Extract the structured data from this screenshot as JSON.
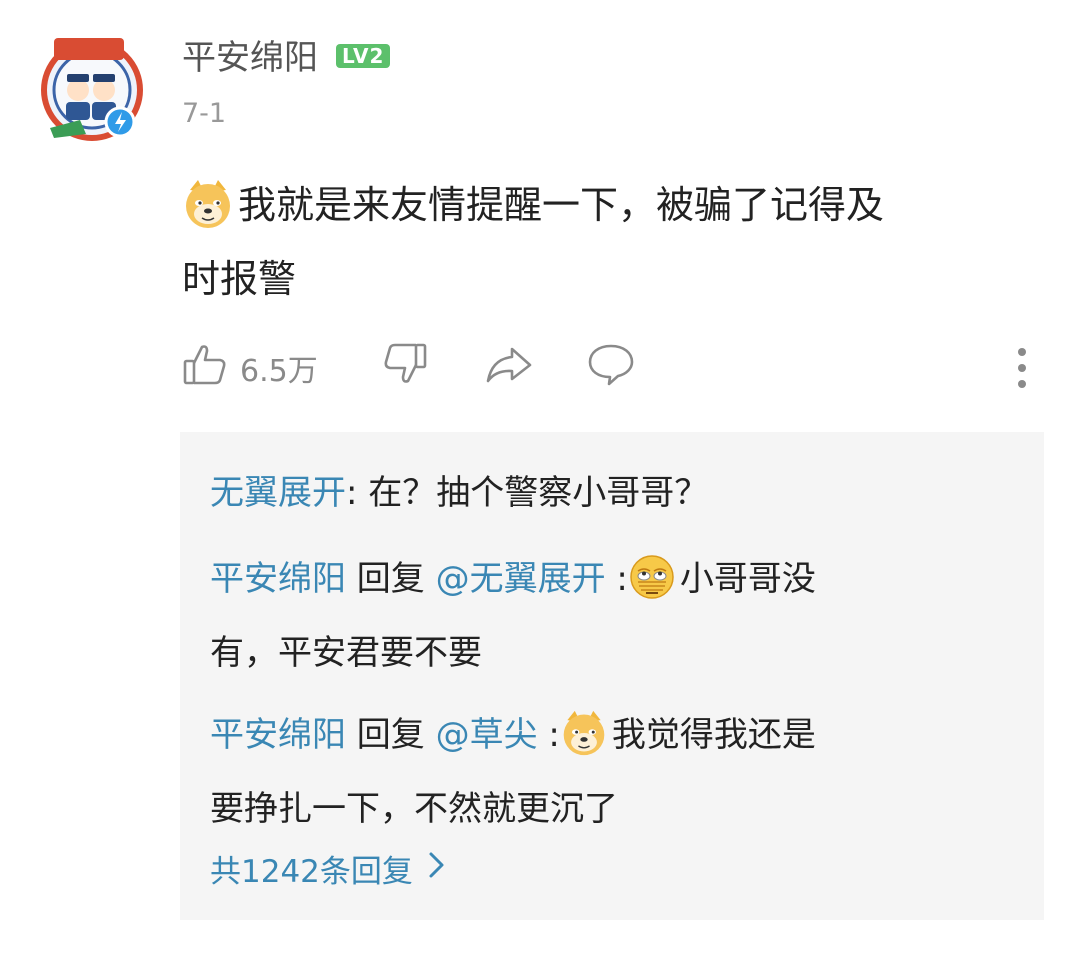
{
  "post": {
    "author": "平安绵阳",
    "level_badge": "LV2",
    "date": "7-1",
    "comment_text_line1": "我就是来友情提醒一下，被骗了记得及",
    "comment_text_line2": "时报警",
    "emoji_icon": "doge-emoji",
    "likes": "6.5万"
  },
  "replies": [
    {
      "author": "无翼展开",
      "separator": ": ",
      "text": "在？抽个警察小哥哥？"
    },
    {
      "author": "平安绵阳",
      "reply_word": " 回复 ",
      "mention": "@无翼展开",
      "separator": " :",
      "emoji_icon": "eye-roll-emoji",
      "text_line1": "小哥哥没",
      "text_line2": "有，平安君要不要"
    },
    {
      "author": "平安绵阳",
      "reply_word": " 回复 ",
      "mention": "@草尖",
      "separator": " :",
      "emoji_icon": "doge-emoji",
      "text_line1": "我觉得我还是",
      "text_line2": "要挣扎一下，不然就更沉了"
    }
  ],
  "reply_count_label": "共1242条回复",
  "colors": {
    "link": "#3a87b4",
    "level_badge": "#5cc06b",
    "reply_background": "#f5f5f5",
    "muted": "#8a8a8a"
  }
}
